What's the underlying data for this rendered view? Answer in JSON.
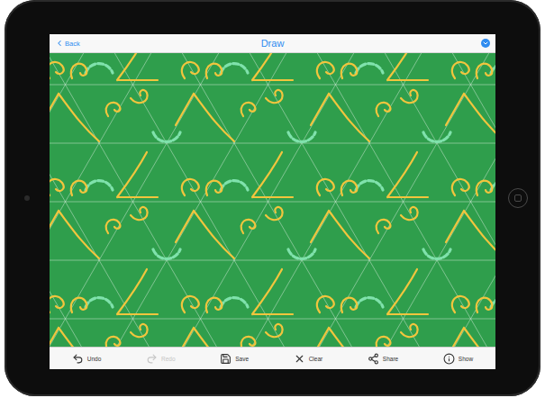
{
  "nav": {
    "back": "Back",
    "title": "Draw"
  },
  "toolbar": [
    {
      "label": "Undo",
      "disabled": false
    },
    {
      "label": "Redo",
      "disabled": true
    },
    {
      "label": "Save",
      "disabled": false
    },
    {
      "label": "Clear",
      "disabled": false
    },
    {
      "label": "Share",
      "disabled": false
    },
    {
      "label": "Show",
      "disabled": false
    }
  ]
}
